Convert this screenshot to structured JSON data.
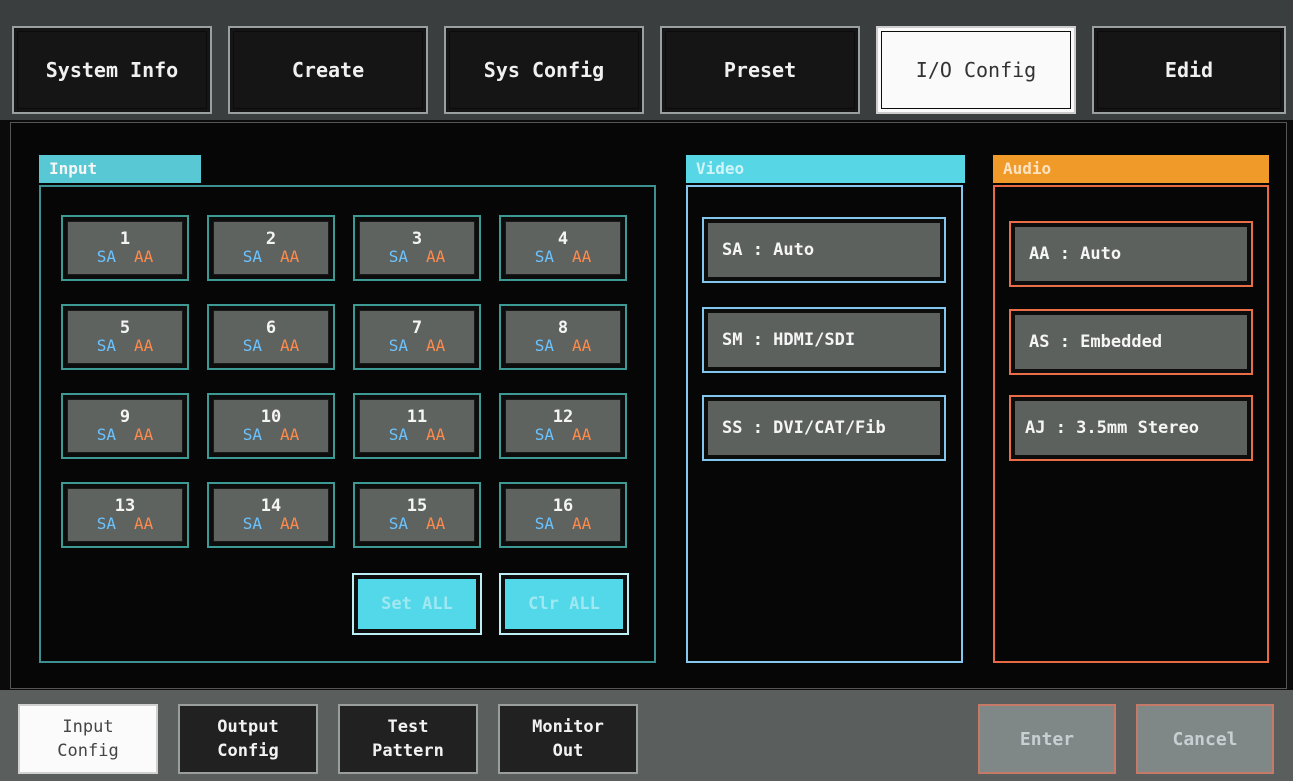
{
  "top_tabs": [
    {
      "label": "System Info",
      "active": false
    },
    {
      "label": "Create",
      "active": false
    },
    {
      "label": "Sys Config",
      "active": false
    },
    {
      "label": "Preset",
      "active": false
    },
    {
      "label": "I/O Config",
      "active": true
    },
    {
      "label": "Edid",
      "active": false
    }
  ],
  "input": {
    "title": "Input",
    "channels": [
      {
        "num": "1",
        "sa": "SA",
        "aa": "AA"
      },
      {
        "num": "2",
        "sa": "SA",
        "aa": "AA"
      },
      {
        "num": "3",
        "sa": "SA",
        "aa": "AA"
      },
      {
        "num": "4",
        "sa": "SA",
        "aa": "AA"
      },
      {
        "num": "5",
        "sa": "SA",
        "aa": "AA"
      },
      {
        "num": "6",
        "sa": "SA",
        "aa": "AA"
      },
      {
        "num": "7",
        "sa": "SA",
        "aa": "AA"
      },
      {
        "num": "8",
        "sa": "SA",
        "aa": "AA"
      },
      {
        "num": "9",
        "sa": "SA",
        "aa": "AA"
      },
      {
        "num": "10",
        "sa": "SA",
        "aa": "AA"
      },
      {
        "num": "11",
        "sa": "SA",
        "aa": "AA"
      },
      {
        "num": "12",
        "sa": "SA",
        "aa": "AA"
      },
      {
        "num": "13",
        "sa": "SA",
        "aa": "AA"
      },
      {
        "num": "14",
        "sa": "SA",
        "aa": "AA"
      },
      {
        "num": "15",
        "sa": "SA",
        "aa": "AA"
      },
      {
        "num": "16",
        "sa": "SA",
        "aa": "AA"
      }
    ],
    "set_all": "Set ALL",
    "clr_all": "Clr ALL"
  },
  "video": {
    "title": "Video",
    "options": [
      "SA : Auto",
      "SM : HDMI/SDI",
      "SS : DVI/CAT/Fib"
    ]
  },
  "audio": {
    "title": "Audio",
    "options": [
      "AA : Auto",
      "AS : Embedded",
      "AJ : 3.5mm Stereo"
    ]
  },
  "bottom_tabs": [
    {
      "line1": "Input",
      "line2": "Config",
      "active": true
    },
    {
      "line1": "Output",
      "line2": "Config",
      "active": false
    },
    {
      "line1": "Test",
      "line2": "Pattern",
      "active": false
    },
    {
      "line1": "Monitor",
      "line2": "Out",
      "active": false
    }
  ],
  "actions": {
    "enter": "Enter",
    "cancel": "Cancel"
  },
  "colors": {
    "input_accent": "#58c8d4",
    "video_accent": "#57d6e6",
    "audio_accent": "#f09a2a",
    "sa_tag": "#6ac3ff",
    "aa_tag": "#ff8a4a"
  }
}
